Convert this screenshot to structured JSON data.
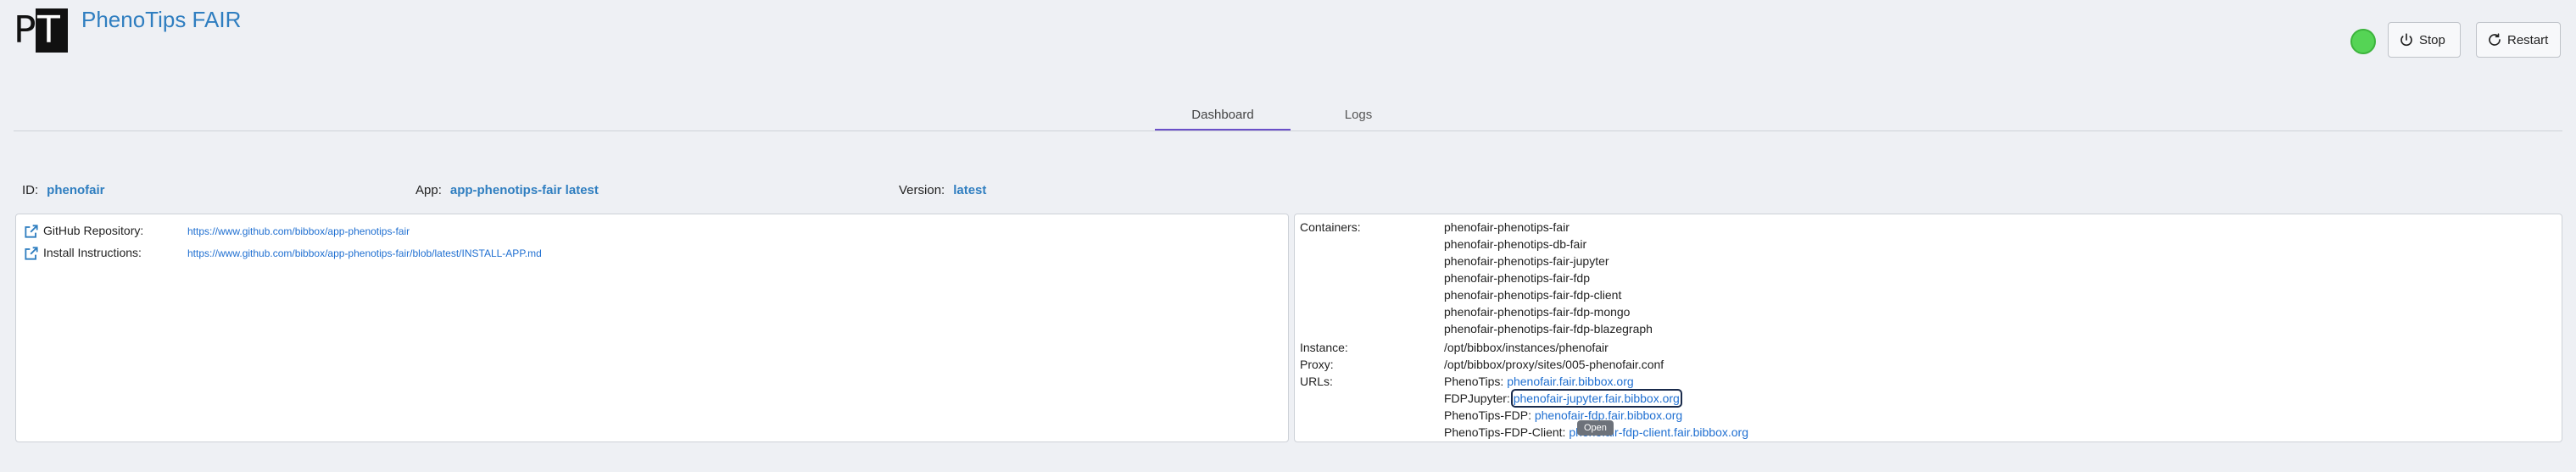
{
  "header": {
    "logo_letters": "PT",
    "title": "PhenoTips FAIR",
    "status_color": "#55d455",
    "stop_label": "Stop",
    "restart_label": "Restart"
  },
  "tabs": [
    {
      "label": "Dashboard",
      "active": true
    },
    {
      "label": "Logs",
      "active": false
    }
  ],
  "meta": {
    "id_label": "ID:",
    "id_value": "phenofair",
    "app_label": "App:",
    "app_value": "app-phenotips-fair latest",
    "version_label": "Version:",
    "version_value": "latest"
  },
  "left_panel": {
    "github_label": "GitHub Repository:",
    "github_url": "https://www.github.com/bibbox/app-phenotips-fair",
    "install_label": "Install Instructions:",
    "install_url": "https://www.github.com/bibbox/app-phenotips-fair/blob/latest/INSTALL-APP.md"
  },
  "right_panel": {
    "containers_label": "Containers:",
    "containers": [
      "phenofair-phenotips-fair",
      "phenofair-phenotips-db-fair",
      "phenofair-phenotips-fair-jupyter",
      "phenofair-phenotips-fair-fdp",
      "phenofair-phenotips-fair-fdp-client",
      "phenofair-phenotips-fair-fdp-mongo",
      "phenofair-phenotips-fair-fdp-blazegraph"
    ],
    "instance_label": "Instance:",
    "instance_value": "/opt/bibbox/instances/phenofair",
    "proxy_label": "Proxy:",
    "proxy_value": "/opt/bibbox/proxy/sites/005-phenofair.conf",
    "urls_label": "URLs:",
    "urls": [
      {
        "name": "PhenoTips:",
        "url": "phenofair.fair.bibbox.org"
      },
      {
        "name": "FDPJupyter:",
        "url": "phenofair-jupyter.fair.bibbox.org"
      },
      {
        "name": "PhenoTips-FDP:",
        "url": "phenofair-fdp.fair.bibbox.org"
      },
      {
        "name": "PhenoTips-FDP-Client:",
        "url": "phenofair-fdp-client.fair.bibbox.org"
      }
    ],
    "tooltip": "Open"
  },
  "icons": {
    "external_link": "external-link-icon",
    "power": "power-icon",
    "restart": "restart-icon"
  }
}
